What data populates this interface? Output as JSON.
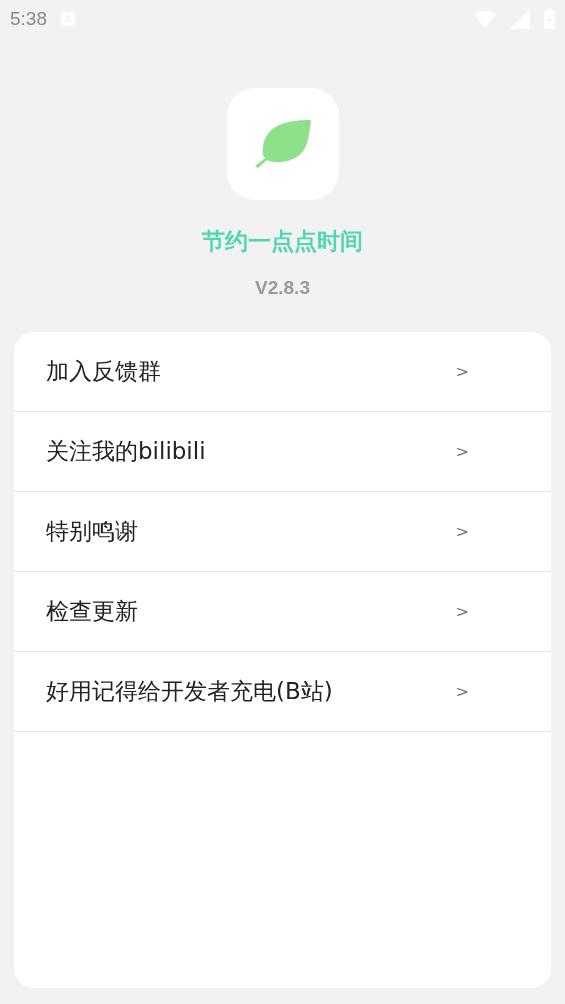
{
  "status_bar": {
    "time": "5:38"
  },
  "app": {
    "name": "节约一点点时间",
    "version": "V2.8.3"
  },
  "menu": [
    {
      "label": "加入反馈群",
      "chevron": ">"
    },
    {
      "label": "关注我的bilibili",
      "chevron": ">"
    },
    {
      "label": "特别鸣谢",
      "chevron": ">"
    },
    {
      "label": "检查更新",
      "chevron": ">"
    },
    {
      "label": "好用记得给开发者充电(B站)",
      "chevron": ">"
    }
  ]
}
